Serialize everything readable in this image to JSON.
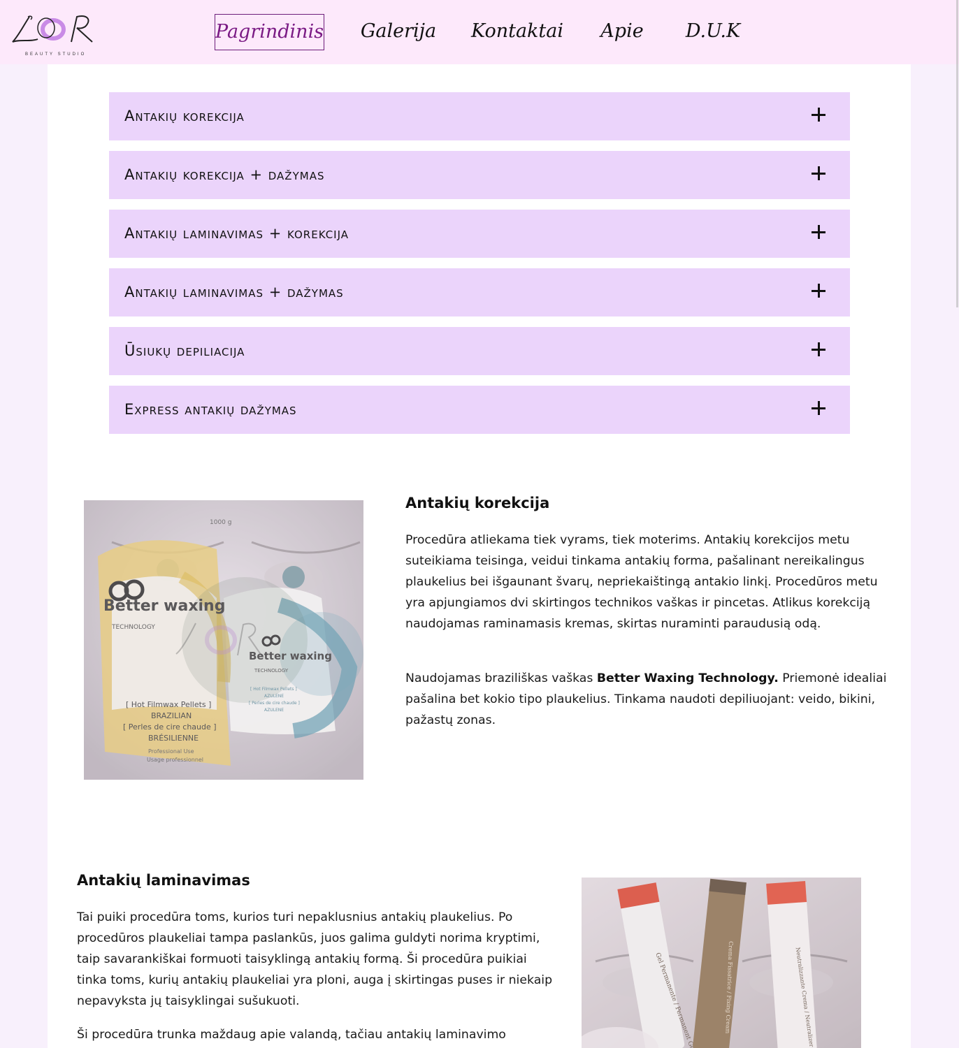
{
  "logo": {
    "letters": "LOR",
    "subtitle": "BEAUTY STUDIO"
  },
  "nav": {
    "items": [
      {
        "label": "Pagrindinis",
        "active": true
      },
      {
        "label": "Galerija",
        "active": false
      },
      {
        "label": "Kontaktai",
        "active": false
      },
      {
        "label": "Apie",
        "active": false
      },
      {
        "label": "D.U.K",
        "active": false
      }
    ]
  },
  "accordion": [
    {
      "label": "Antakių korekcija"
    },
    {
      "label": "Antakių korekcija + dažymas"
    },
    {
      "label": "Antakių laminavimas + korekcija"
    },
    {
      "label": "Antakių laminavimas + dažymas"
    },
    {
      "label": "Ūsiukų depiliacija"
    },
    {
      "label": "Express antakių dažymas"
    }
  ],
  "section1": {
    "title": "Antakių korekcija",
    "p1": "Procedūra atliekama tiek vyrams, tiek moterims. Antakių korekcijos metu suteikiama teisinga, veidui tinkama antakių forma, pašalinant nereikalingus plaukelius bei išgaunant švarų, nepriekaištingą antakio linkį. Procedūros metu yra apjungiamos dvi skirtingos technikos vaškas ir pincetas. Atlikus korekciją naudojamas raminamasis kremas, skirtas nuraminti paraudusią odą.",
    "p2_pre": "Naudojamas braziliškas vaškas ",
    "p2_bold": "Better Waxing Technology.",
    "p2_post": " Priemonė idealiai pašalina bet kokio tipo plaukelius. Tinkama naudoti depiliuojant: veido, bikini, pažastų zonas.",
    "image": {
      "brand_top": "Better waxing",
      "brand_sub": "TECHNOLOGY",
      "pack_text_1": "[ Hot Filmwax Pellets ]",
      "pack_text_2": "BRAZILIAN",
      "pack_text_3": "[ Perles de cire chaude ]",
      "pack_text_4": "BRÉSILIENNE",
      "pack_text_5": "Professional Use",
      "pack_text_6": "Usage professionnel",
      "pack_weight": "1000 g",
      "blue_brand": "Better waxing",
      "blue_sub": "TECHNOLOGY",
      "blue_text_1": "[ Hot Filmwax Pellets ]",
      "blue_text_2": "AZULENE",
      "blue_text_3": "[ Perles de cire chaude ]",
      "blue_text_4": "AZULENE"
    }
  },
  "section2": {
    "title": "Antakių laminavimas",
    "p1": "Tai puiki procedūra toms, kurios turi nepaklusnius antakių plaukelius. Po procedūros plaukeliai tampa paslankūs, juos galima guldyti norima kryptimi, taip savarankiškai formuoti taisyklingą antakių formą. Ši procedūra puikiai tinka toms, kurių antakių plaukeliai yra ploni, auga į skirtingas puses ir niekaip nepavyksta jų taisyklingai sušukuoti.",
    "p2": "Ši procedūra trunka maždaug apie valandą, tačiau antakių laminavimo",
    "image": {
      "tube_1_text": "Gel Permanente / Permanent Gel",
      "tube_2_text": "Crema Fissatrice / Fixing Cream",
      "tube_3_text": "Neutralizzante Crema / Neutralizer Cream"
    }
  },
  "colors": {
    "header_bg": "#fde9fb",
    "accordion_bg": "#ebd4fb",
    "page_bg": "#f8f0fc",
    "active_nav": "#7a1a84"
  }
}
